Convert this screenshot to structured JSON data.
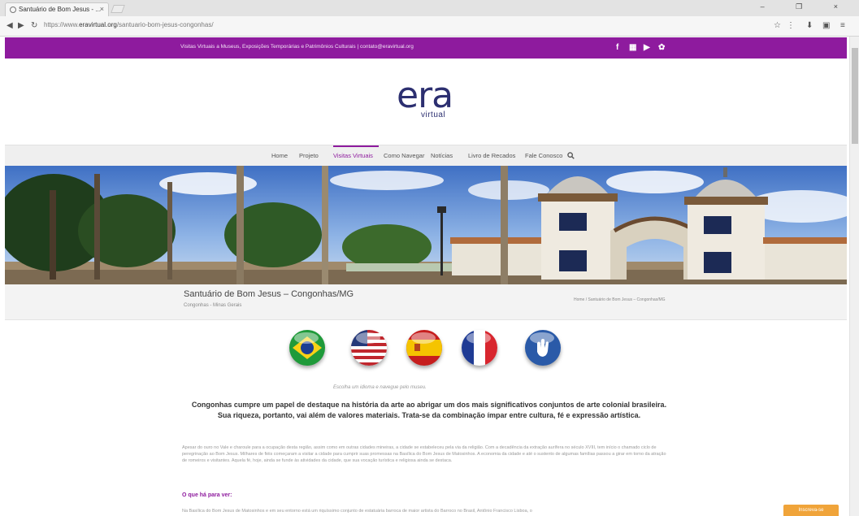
{
  "browser": {
    "tab_title": "Santuário de Bom Jesus - ...",
    "tab_close": "×",
    "window_buttons": "– ❐ ×",
    "url_prefix": "https://www.",
    "url_domain": "eravirtual.org",
    "url_path": "/santuario-bom-jesus-congonhas/",
    "nav_back": "◀",
    "nav_forward": "▶",
    "nav_reload": "↻",
    "right_icons": [
      "☆",
      "⋮",
      "⬇",
      "▣",
      "≡"
    ]
  },
  "site": {
    "accent_color": "#8e1b9e",
    "topbar_text": "Visitas Virtuais a Museus, Exposições Temporárias e Patrimônios Culturais  |  contato@eravirtual.org",
    "social_icons": [
      "f",
      "▦",
      "▶",
      "✿"
    ],
    "logo_main": "era",
    "logo_sub": "virtual",
    "menu": [
      {
        "label": "Home",
        "active": false
      },
      {
        "label": "Projeto",
        "active": false
      },
      {
        "label": "Visitas Virtuais",
        "active": true
      },
      {
        "label": "Como Navegar",
        "active": false
      },
      {
        "label": "Notícias",
        "active": false
      },
      {
        "label": "Livro de Recados",
        "active": false
      },
      {
        "label": "Fale Conosco",
        "active": false
      }
    ],
    "search_icon": "search-icon"
  },
  "page": {
    "title": "Santuário de Bom Jesus – Congonhas/MG",
    "subtitle": "Congonhas - Minas Gerais",
    "breadcrumb": "Home / Santuário de Bom Jesus – Congonhas/MG",
    "languages": [
      "Português",
      "English",
      "Español",
      "Français",
      "Libras"
    ],
    "choose_language": "Escolha um idioma e navegue pelo museu.",
    "intro": "Congonhas cumpre um papel de destaque na história da arte ao abrigar um dos mais significativos conjuntos de arte colonial brasileira. Sua riqueza, portanto, vai além de valores materiais. Trata-se da combinação ímpar entre cultura, fé e expressão artística.",
    "paragraph": "Apesar do ouro no Vale e charoule para a ocupação desta região, assim como em outras cidades mineiras, a cidade se estabeleceu pela via da religião. Com a decadência da extração aurífera no século XVIII, tem início o chamado ciclo de peregrinação ao Bom Jesus. Milhares de fiéis começaram a visitar a cidade para cumprir suas promessas na Basílica do Bom Jesus de Matosinhos. A economia da cidade e até o sustento de algumas famílias passou a girar em torno da atração de romeiros e visitantes. Aquela fé, hoje, ainda se funde às atividades da cidade, que sua vocação turística e religiosa ainda se destaca.",
    "section_heading": "O que há para ver:",
    "paragraph2": "Na Basílica do Bom Jesus de Matosinhos e em seu entorno está um riquíssimo conjunto de estatuária barroca de maior artista do Barroco no Brasil, Antônio Francisco Lisboa, o",
    "float_button": "Inscreva-se"
  }
}
